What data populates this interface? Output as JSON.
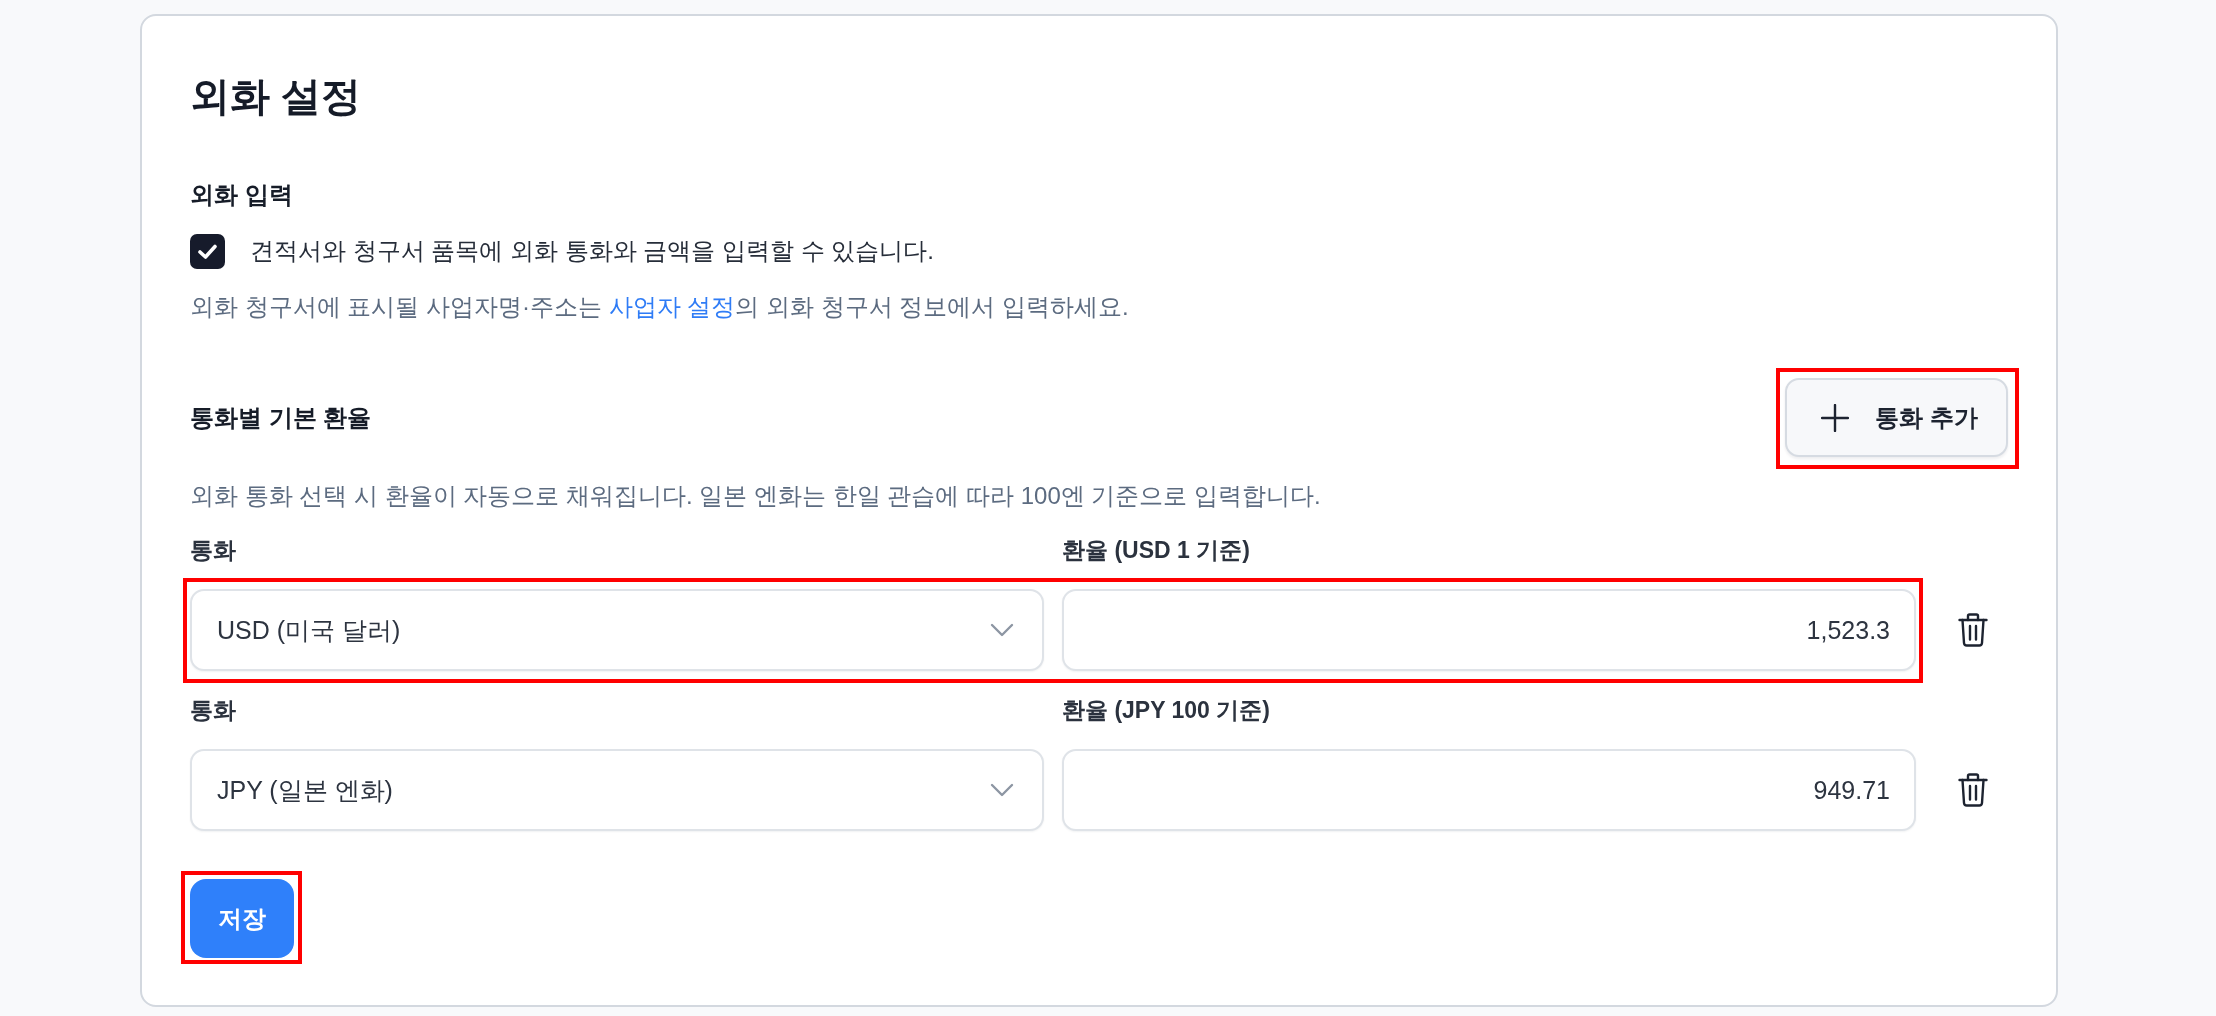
{
  "page": {
    "title": "외화 설정"
  },
  "foreign_input": {
    "heading": "외화 입력",
    "checkbox": {
      "label": "견적서와 청구서 품목에 외화 통화와 금액을 입력할 수 있습니다.",
      "checked": true
    },
    "note": {
      "text_before": "외화 청구서에 표시될 사업자명·주소는 ",
      "link": "사업자 설정",
      "text_after": "의 외화 청구서 정보에서 입력하세요."
    }
  },
  "rates": {
    "heading": "통화별 기본 환율",
    "add_button": {
      "label": "통화 추가",
      "highlighted": true
    },
    "description": "외화 통화 선택 시 환율이 자동으로 채워집니다. 일본 엔화는 한일 관습에 따라 100엔 기준으로 입력합니다.",
    "rows": [
      {
        "currency_label": "통화",
        "currency": "USD (미국 달러)",
        "rate_label": "환율 (USD 1 기준)",
        "rate": "1,523.3",
        "highlighted": true
      },
      {
        "currency_label": "통화",
        "currency": "JPY (일본 엔화)",
        "rate_label": "환율 (JPY 100 기준)",
        "rate": "949.71",
        "highlighted": false
      }
    ]
  },
  "save_button": {
    "label": "저장",
    "highlighted": true
  }
}
